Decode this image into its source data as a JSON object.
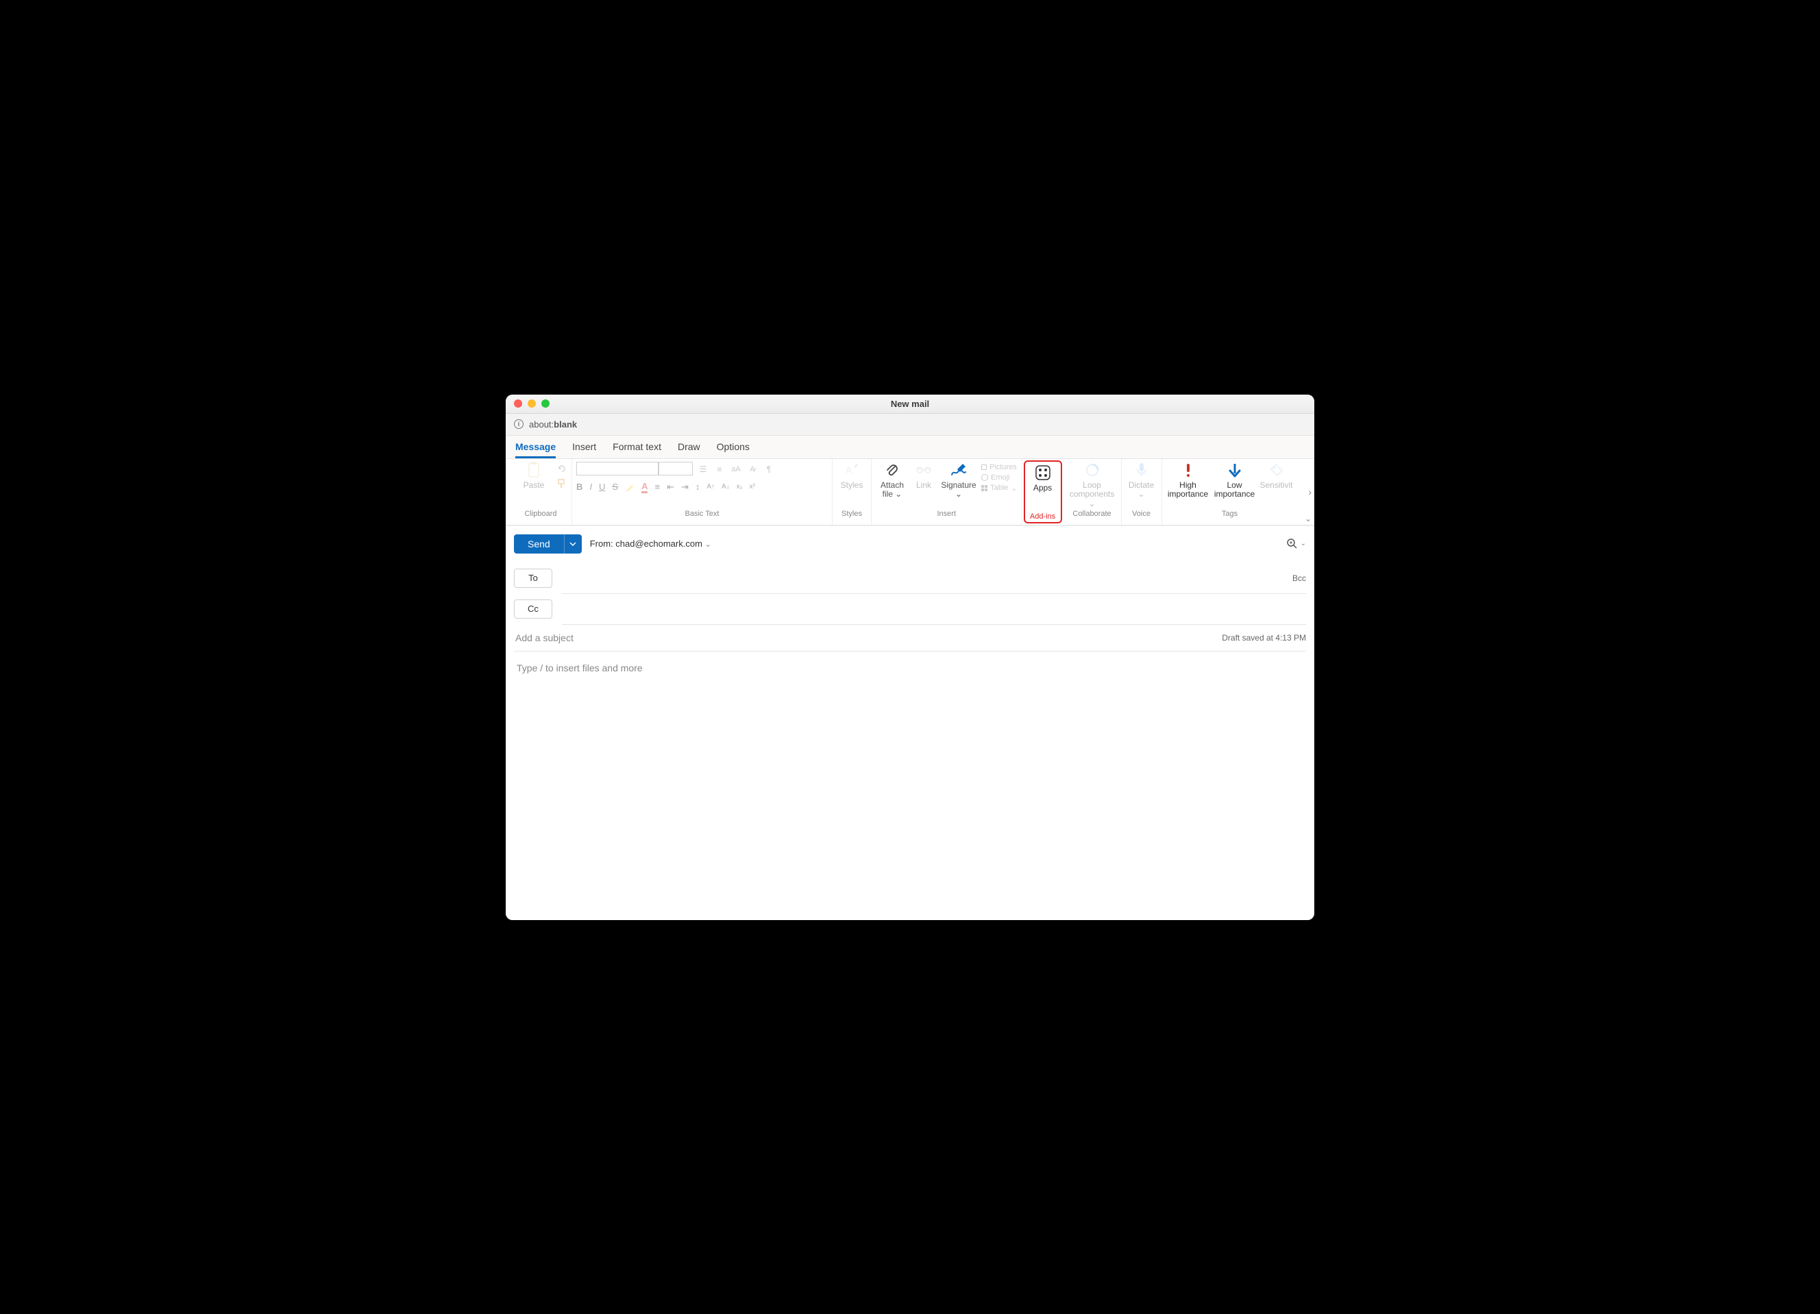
{
  "window": {
    "title": "New mail"
  },
  "address": {
    "prefix": "about:",
    "path": "blank"
  },
  "tabs": [
    {
      "label": "Message",
      "active": true
    },
    {
      "label": "Insert"
    },
    {
      "label": "Format text"
    },
    {
      "label": "Draw"
    },
    {
      "label": "Options"
    }
  ],
  "ribbon": {
    "clipboard": {
      "paste": "Paste",
      "label": "Clipboard"
    },
    "basicText": {
      "label": "Basic Text"
    },
    "styles": {
      "btn": "Styles",
      "label": "Styles"
    },
    "insert": {
      "attach": "Attach file",
      "link": "Link",
      "signature": "Signature",
      "pictures": "Pictures",
      "emoji": "Emoji",
      "table": "Table",
      "label": "Insert"
    },
    "addins": {
      "apps": "Apps",
      "label": "Add-ins"
    },
    "collaborate": {
      "loop": "Loop components",
      "label": "Collaborate"
    },
    "voice": {
      "dictate": "Dictate",
      "label": "Voice"
    },
    "tags": {
      "high": "High importance",
      "low": "Low importance",
      "sens": "Sensitivit",
      "label": "Tags"
    }
  },
  "compose": {
    "send": "Send",
    "from_label": "From:",
    "from_email": "chad@echomark.com",
    "to": "To",
    "cc": "Cc",
    "bcc": "Bcc",
    "subject_placeholder": "Add a subject",
    "draft_status": "Draft saved at 4:13 PM",
    "body_placeholder": "Type / to insert files and more"
  }
}
